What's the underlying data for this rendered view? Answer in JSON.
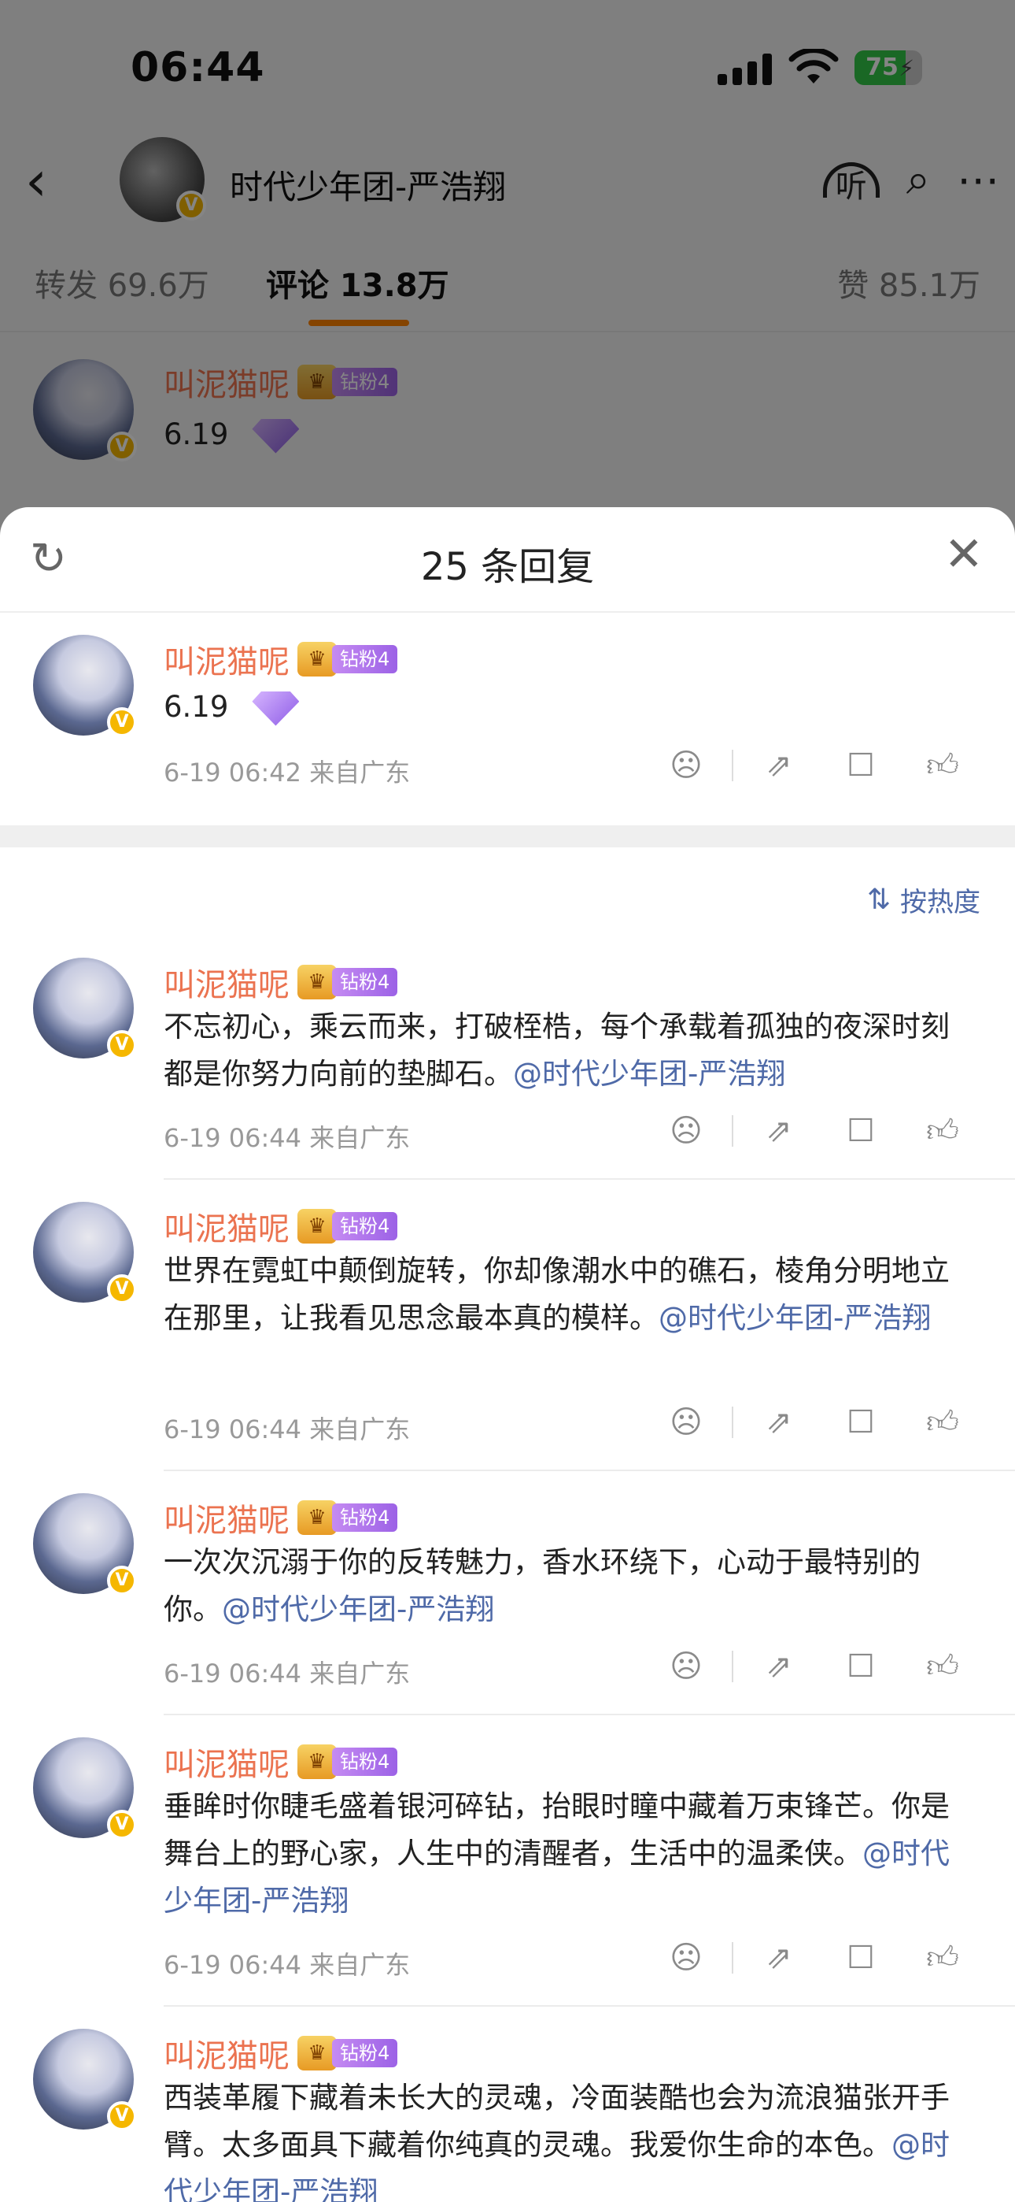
{
  "status_bar": {
    "time": "06:44",
    "battery_percent": "75",
    "battery_level": 0.75
  },
  "nav": {
    "title": "时代少年团-严浩翔",
    "back_icon": "chevron-left-icon",
    "listen_label": "听",
    "icons": [
      "headphones-icon",
      "search-icon",
      "more-icon"
    ]
  },
  "tabs": [
    {
      "label": "转发 69.6万"
    },
    {
      "label": "评论 13.8万"
    },
    {
      "label": "赞 85.1万"
    }
  ],
  "background_comment": {
    "user": "叫泥猫呢",
    "badge": "钻粉4",
    "text": "6.19"
  },
  "sheet": {
    "title": "25 条回复",
    "sort_label": "按热度",
    "main_comment": {
      "user": "叫泥猫呢",
      "badge": "钻粉4",
      "text": "6.19",
      "meta": "6-19 06:42  来自广东"
    },
    "replies": [
      {
        "user": "叫泥猫呢",
        "badge": "钻粉4",
        "text": "不忘初心，乘云而来，打破桎梏，每个承载着孤独的夜深时刻都是你努力向前的垫脚石。",
        "mention": "@时代少年团-严浩翔",
        "meta": "6-19 06:44  来自广东"
      },
      {
        "user": "叫泥猫呢",
        "badge": "钻粉4",
        "text": "世界在霓虹中颠倒旋转，你却像潮水中的礁石，棱角分明地立在那里，让我看见思念最本真的模样。",
        "mention": "@时代少年团-严浩翔",
        "meta": "6-19 06:44  来自广东"
      },
      {
        "user": "叫泥猫呢",
        "badge": "钻粉4",
        "text": "一次次沉溺于你的反转魅力，香水环绕下，心动于最特别的你。",
        "mention": "@时代少年团-严浩翔",
        "meta": "6-19 06:44  来自广东"
      },
      {
        "user": "叫泥猫呢",
        "badge": "钻粉4",
        "text": "垂眸时你睫毛盛着银河碎钻，抬眼时瞳中藏着万束锋芒。你是舞台上的野心家，人生中的清醒者，生活中的温柔侠。",
        "mention": "@时代少年团-严浩翔",
        "meta": "6-19 06:44  来自广东"
      },
      {
        "user": "叫泥猫呢",
        "badge": "钻粉4",
        "text": "西装革履下藏着未长大的灵魂，冷面装酷也会为流浪猫张开手臂。太多面具下藏着你纯真的灵魂。我爱你生命的本色。",
        "mention": "@时代少年团-严浩翔",
        "meta": ""
      }
    ]
  },
  "colors": {
    "accent": "#ff8200",
    "username": "#eb7350",
    "mention": "#4f6aa8",
    "verified": "#f5b700"
  }
}
